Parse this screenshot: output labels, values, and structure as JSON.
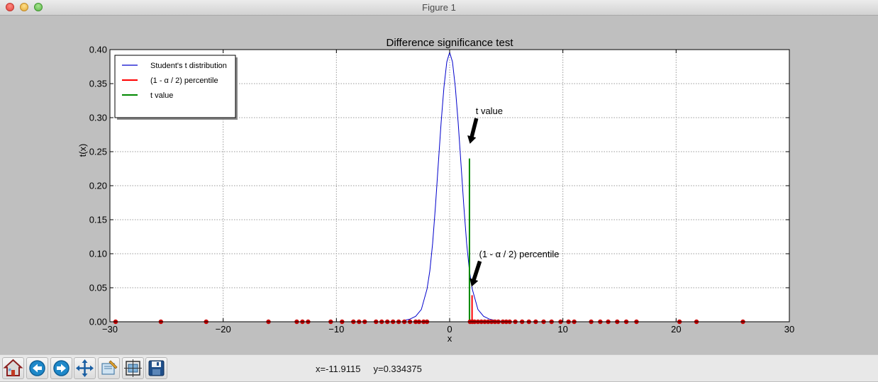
{
  "window": {
    "title": "Figure 1"
  },
  "chart_data": {
    "type": "line",
    "title": "Difference significance test",
    "xlabel": "x",
    "ylabel": "t(x)",
    "xlim": [
      -30,
      30
    ],
    "ylim": [
      0,
      0.4
    ],
    "xticks": [
      -30,
      -20,
      -10,
      0,
      10,
      20,
      30
    ],
    "xtick_labels": [
      "−30",
      "−20",
      "−10",
      "0",
      "10",
      "20",
      "30"
    ],
    "yticks": [
      0.0,
      0.05,
      0.1,
      0.15,
      0.2,
      0.25,
      0.3,
      0.35,
      0.4
    ],
    "ytick_labels": [
      "0.00",
      "0.05",
      "0.10",
      "0.15",
      "0.20",
      "0.25",
      "0.30",
      "0.35",
      "0.40"
    ],
    "grid": true,
    "legend_position": "top-left",
    "series": [
      {
        "name": "Student's t distribution",
        "color": "#0000cc",
        "kind": "curve",
        "x": [
          -4,
          -3.5,
          -3,
          -2.5,
          -2,
          -1.75,
          -1.5,
          -1.25,
          -1,
          -0.75,
          -0.5,
          -0.25,
          0,
          0.25,
          0.5,
          0.75,
          1,
          1.25,
          1.5,
          1.75,
          2,
          2.5,
          3,
          3.5,
          4,
          5
        ],
        "y": [
          0.002,
          0.004,
          0.008,
          0.018,
          0.048,
          0.075,
          0.115,
          0.17,
          0.232,
          0.293,
          0.345,
          0.382,
          0.396,
          0.382,
          0.345,
          0.293,
          0.232,
          0.17,
          0.115,
          0.075,
          0.048,
          0.018,
          0.008,
          0.004,
          0.002,
          0.0
        ]
      },
      {
        "name": "(1 - α / 2) percentile",
        "color": "#ff0000",
        "kind": "vline",
        "x": 1.98,
        "y": 0.039
      },
      {
        "name": "t value",
        "color": "#008800",
        "kind": "vline",
        "x": 1.75,
        "y": 0.24
      }
    ],
    "scatter_markers": {
      "color": "#cc0000",
      "y": 0.0,
      "x": [
        -29.5,
        -25.5,
        -21.5,
        -16,
        -13.5,
        -13,
        -12.5,
        -10.5,
        -9.5,
        -8.5,
        -8,
        -7.5,
        -6.5,
        -6,
        -5.5,
        -5,
        -4.5,
        -4,
        -3.5,
        -3,
        -2.7,
        -2.3,
        -2,
        1.8,
        2,
        2.2,
        2.5,
        2.8,
        3.1,
        3.4,
        3.7,
        4,
        4.3,
        4.7,
        5,
        5.3,
        5.8,
        6.4,
        7,
        7.6,
        8.3,
        9,
        9.8,
        10.5,
        11,
        12.5,
        13.3,
        14,
        14.8,
        15.6,
        16.5,
        20.3,
        21.8,
        25.9
      ]
    },
    "annotations": [
      {
        "text": "t value",
        "text_x": 2.3,
        "text_y": 0.305,
        "arrow_x": 1.8,
        "arrow_y": 0.262
      },
      {
        "text": "(1 - α / 2) percentile",
        "text_x": 2.6,
        "text_y": 0.095,
        "arrow_x": 1.95,
        "arrow_y": 0.052
      }
    ]
  },
  "toolbar": {
    "buttons": [
      {
        "icon": "home-icon",
        "tip": "Reset original view"
      },
      {
        "icon": "back-icon",
        "tip": "Back to previous view"
      },
      {
        "icon": "forward-icon",
        "tip": "Forward to next view"
      },
      {
        "icon": "pan-icon",
        "tip": "Pan axes"
      },
      {
        "icon": "zoom-icon",
        "tip": "Zoom to rectangle"
      },
      {
        "icon": "subplots-icon",
        "tip": "Configure subplots"
      },
      {
        "icon": "save-icon",
        "tip": "Save the figure"
      }
    ],
    "coord_x": "x=-11.9115",
    "coord_y": "y=0.334375"
  }
}
